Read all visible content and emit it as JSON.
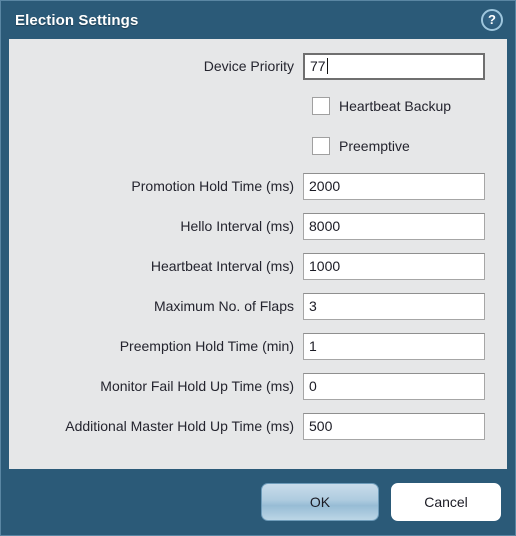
{
  "window": {
    "title": "Election Settings",
    "help_icon_label": "?",
    "accent_color": "#2b5a78",
    "panel_color": "#e6e7e8"
  },
  "form": {
    "rows": [
      {
        "type": "text",
        "label": "Device Priority",
        "value": "77",
        "focused": true
      },
      {
        "type": "checkbox",
        "label": "Heartbeat Backup",
        "checked": false
      },
      {
        "type": "checkbox",
        "label": "Preemptive",
        "checked": false
      },
      {
        "type": "text",
        "label": "Promotion Hold Time (ms)",
        "value": "2000",
        "focused": false
      },
      {
        "type": "text",
        "label": "Hello Interval (ms)",
        "value": "8000",
        "focused": false
      },
      {
        "type": "text",
        "label": "Heartbeat Interval (ms)",
        "value": "1000",
        "focused": false
      },
      {
        "type": "text",
        "label": "Maximum No. of Flaps",
        "value": "3",
        "focused": false
      },
      {
        "type": "text",
        "label": "Preemption Hold Time (min)",
        "value": "1",
        "focused": false
      },
      {
        "type": "text",
        "label": "Monitor Fail Hold Up Time (ms)",
        "value": "0",
        "focused": false
      },
      {
        "type": "text",
        "label": "Additional Master Hold Up Time (ms)",
        "value": "500",
        "focused": false
      }
    ]
  },
  "footer": {
    "ok_label": "OK",
    "cancel_label": "Cancel"
  }
}
